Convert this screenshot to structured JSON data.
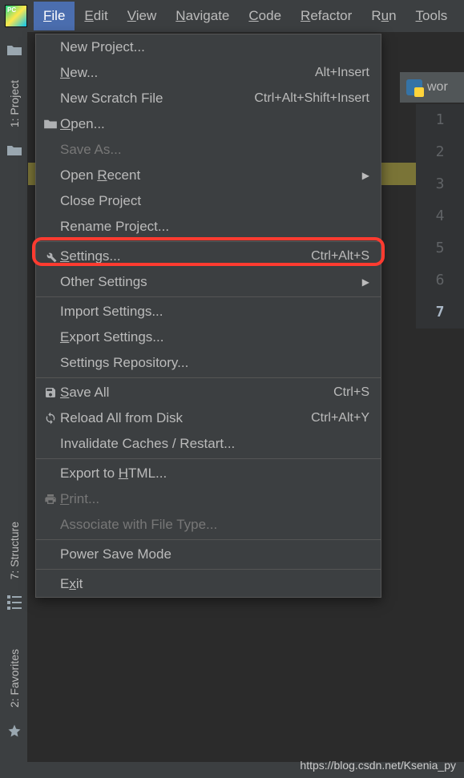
{
  "menubar": {
    "items": [
      {
        "prefix": "F",
        "rest": "ile"
      },
      {
        "prefix": "E",
        "rest": "dit"
      },
      {
        "prefix": "V",
        "rest": "iew"
      },
      {
        "prefix": "N",
        "rest": "avigate"
      },
      {
        "prefix": "C",
        "rest": "ode"
      },
      {
        "prefix": "R",
        "rest": "efactor"
      },
      {
        "prefix": "",
        "rest": "R",
        "mid": "u",
        "suffix": "n"
      },
      {
        "prefix": "T",
        "rest": "ools"
      }
    ]
  },
  "rails": {
    "project": "1: Project",
    "structure": "7: Structure",
    "favorites": "2: Favorites"
  },
  "editor": {
    "tab": "wor",
    "lines": [
      "1",
      "2",
      "3",
      "4",
      "5",
      "6",
      "7"
    ]
  },
  "dropdown": {
    "items": [
      {
        "label_pre": "",
        "u": "",
        "label_post": "New Project...",
        "shortcut": "",
        "icon": "",
        "enabled": true
      },
      {
        "label_pre": "",
        "u": "N",
        "label_post": "ew...",
        "shortcut": "Alt+Insert",
        "icon": "",
        "enabled": true
      },
      {
        "label_pre": "",
        "u": "",
        "label_post": "New Scratch File",
        "shortcut": "Ctrl+Alt+Shift+Insert",
        "icon": "",
        "enabled": true
      },
      {
        "label_pre": "",
        "u": "O",
        "label_post": "pen...",
        "shortcut": "",
        "icon": "folder",
        "enabled": true
      },
      {
        "label_pre": "",
        "u": "",
        "label_post": "Save As...",
        "shortcut": "",
        "icon": "",
        "enabled": false
      },
      {
        "label_pre": "Open ",
        "u": "R",
        "label_post": "ecent",
        "shortcut": "",
        "icon": "",
        "enabled": true,
        "submenu": true
      },
      {
        "label_pre": "",
        "u": "",
        "label_post": "Close Project",
        "shortcut": "",
        "icon": "",
        "enabled": true
      },
      {
        "label_pre": "",
        "u": "",
        "label_post": "Rename Project...",
        "shortcut": "",
        "icon": "",
        "enabled": true
      },
      {
        "sep": true
      },
      {
        "label_pre": "",
        "u": "S",
        "label_post": "ettings...",
        "shortcut": "Ctrl+Alt+S",
        "icon": "wrench",
        "enabled": true
      },
      {
        "label_pre": "",
        "u": "",
        "label_post": "Other Settings",
        "shortcut": "",
        "icon": "",
        "enabled": true,
        "submenu": true
      },
      {
        "sep": true
      },
      {
        "label_pre": "",
        "u": "",
        "label_post": "Import Settings...",
        "shortcut": "",
        "icon": "",
        "enabled": true
      },
      {
        "label_pre": "",
        "u": "E",
        "label_post": "xport Settings...",
        "shortcut": "",
        "icon": "",
        "enabled": true
      },
      {
        "label_pre": "",
        "u": "",
        "label_post": "Settings Repository...",
        "shortcut": "",
        "icon": "",
        "enabled": true
      },
      {
        "sep": true
      },
      {
        "label_pre": "",
        "u": "S",
        "label_post": "ave All",
        "shortcut": "Ctrl+S",
        "icon": "save",
        "enabled": true
      },
      {
        "label_pre": "",
        "u": "",
        "label_post": "Reload All from Disk",
        "shortcut": "Ctrl+Alt+Y",
        "icon": "reload",
        "enabled": true
      },
      {
        "label_pre": "",
        "u": "",
        "label_post": "Invalidate Caches / Restart...",
        "shortcut": "",
        "icon": "",
        "enabled": true
      },
      {
        "sep": true
      },
      {
        "label_pre": "Export to ",
        "u": "H",
        "label_post": "TML...",
        "shortcut": "",
        "icon": "",
        "enabled": true
      },
      {
        "label_pre": "",
        "u": "P",
        "label_post": "rint...",
        "shortcut": "",
        "icon": "print",
        "enabled": false
      },
      {
        "label_pre": "",
        "u": "",
        "label_post": "Associate with File Type...",
        "shortcut": "",
        "icon": "",
        "enabled": false
      },
      {
        "sep": true
      },
      {
        "label_pre": "",
        "u": "",
        "label_post": "Power Save Mode",
        "shortcut": "",
        "icon": "",
        "enabled": true
      },
      {
        "sep": true
      },
      {
        "label_pre": "E",
        "u": "x",
        "label_post": "it",
        "shortcut": "",
        "icon": "",
        "enabled": true
      }
    ]
  },
  "watermark": "https://blog.csdn.net/Ksenia_py"
}
